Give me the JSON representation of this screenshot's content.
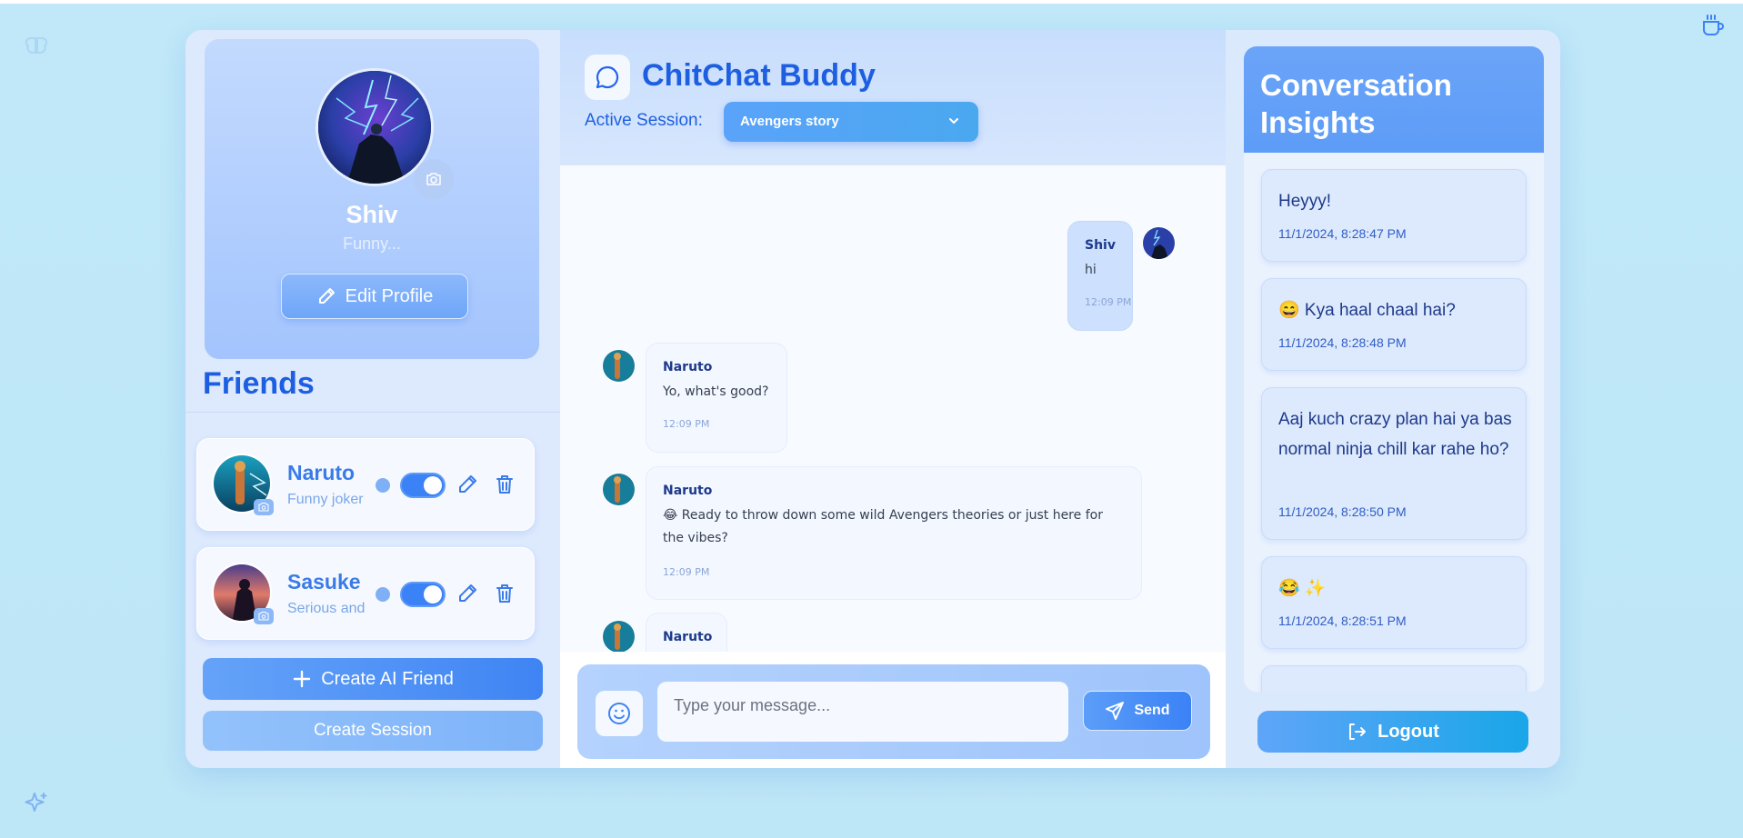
{
  "app": {
    "title": "ChitChat Buddy"
  },
  "profile": {
    "name": "Shiv",
    "status": "Funny...",
    "edit_label": "Edit Profile"
  },
  "friends": {
    "title": "Friends",
    "items": [
      {
        "name": "Naruto",
        "description": "Funny joker",
        "enabled": true
      },
      {
        "name": "Sasuke",
        "description": "Serious and",
        "enabled": true
      }
    ],
    "create_friend_label": "Create AI Friend",
    "create_session_label": "Create Session"
  },
  "session": {
    "label": "Active Session:",
    "selected": "Avengers story"
  },
  "messages": [
    {
      "author": "Shiv",
      "text": "hi",
      "time": "12:09 PM",
      "mine": true
    },
    {
      "author": "Naruto",
      "text": "Yo, what's good?",
      "time": "12:09 PM",
      "mine": false
    },
    {
      "author": "Naruto",
      "text": "😂 Ready to throw down some wild Avengers theories or just here for the vibes?",
      "time": "12:09 PM",
      "mine": false
    },
    {
      "author": "Naruto",
      "text": "",
      "time": "",
      "mine": false
    }
  ],
  "composer": {
    "placeholder": "Type your message...",
    "send_label": "Send"
  },
  "insights": {
    "title": "Conversation Insights",
    "items": [
      {
        "text": "Heyyy!",
        "time": "11/1/2024, 8:28:47 PM"
      },
      {
        "text": "😄 Kya haal chaal hai?",
        "time": "11/1/2024, 8:28:48 PM"
      },
      {
        "text": "Aaj kuch crazy plan hai ya bas normal ninja chill kar rahe ho?",
        "time": "11/1/2024, 8:28:50 PM"
      },
      {
        "text": "😂 ✨",
        "time": "11/1/2024, 8:28:51 PM"
      }
    ]
  },
  "logout_label": "Logout",
  "icons": {
    "brand": "sparkles-icon",
    "coffee": "coffee-icon",
    "chat": "message-circle-icon",
    "edit": "pencil-icon",
    "delete": "trash-icon",
    "camera": "camera-icon",
    "add": "plus-icon",
    "emoji": "smile-icon",
    "send": "send-icon",
    "logout": "logout-icon",
    "dropdown": "chevron-down-icon"
  },
  "colors": {
    "accent": "#1d5fe0",
    "primary_button": "#3b82f6",
    "background": "#c0e8f8"
  }
}
